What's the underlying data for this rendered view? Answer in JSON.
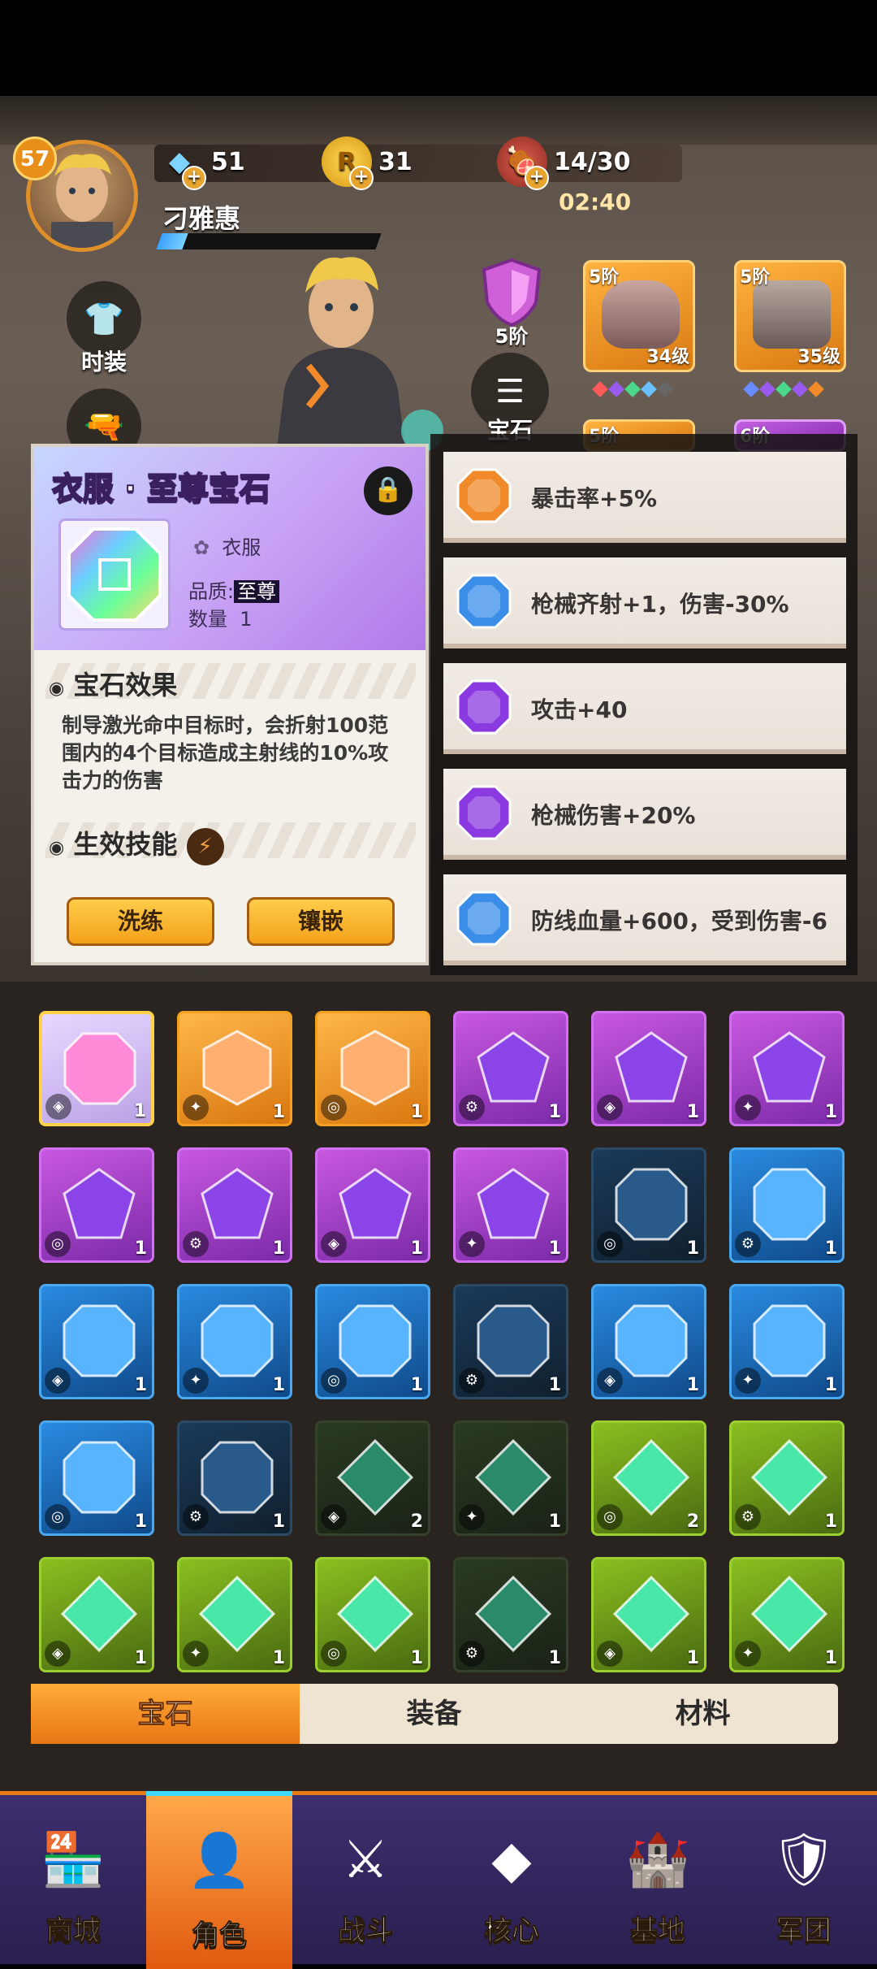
{
  "player": {
    "level": "57",
    "name": "刁雅惠",
    "xp_fraction": 0.12
  },
  "resources": [
    {
      "name": "diamond",
      "icon": "diamond-icon",
      "value": "51"
    },
    {
      "name": "r-coin",
      "icon": "r-coin-icon",
      "value": "31"
    },
    {
      "name": "stamina",
      "icon": "meat-icon",
      "value": "14/30"
    }
  ],
  "timer": "02:40",
  "side_buttons": [
    {
      "label": "时装",
      "icon": "outfit-icon"
    },
    {
      "label": "宝石",
      "icon": "list-icon"
    }
  ],
  "shield_tier": "5阶",
  "equipment": [
    {
      "tier": "5阶",
      "level": "34级"
    },
    {
      "tier": "5阶",
      "level": "35级"
    },
    {
      "tier": "5阶",
      "level": ""
    },
    {
      "tier": "6阶",
      "level": ""
    }
  ],
  "popup": {
    "title": "衣服 · 至尊宝石",
    "slot_label": "衣服",
    "quality_label": "品质:",
    "quality_value": "至尊",
    "count_label": "数量",
    "count_value": "1",
    "effect_title": "宝石效果",
    "effect_desc": "制导激光命中目标时，会折射100范围内的4个目标造成主射线的10%攻击力的伤害",
    "skill_title": "生效技能",
    "btn_refine": "洗练",
    "btn_inlay": "镶嵌"
  },
  "stats": [
    {
      "text": "暴击率+5%",
      "color": "#f08a2a"
    },
    {
      "text": "枪械齐射+1，伤害-30%",
      "color": "#3a8ee8"
    },
    {
      "text": "攻击+40",
      "color": "#8a3ae0"
    },
    {
      "text": "枪械伤害+20%",
      "color": "#8a3ae0"
    },
    {
      "text": "防线血量+600，受到伤害-6",
      "color": "#3a8ee8"
    }
  ],
  "inventory": [
    {
      "kind": "rainbow",
      "count": "1"
    },
    {
      "kind": "orange",
      "count": "1"
    },
    {
      "kind": "orange",
      "count": "1"
    },
    {
      "kind": "purple",
      "count": "1"
    },
    {
      "kind": "purple",
      "count": "1"
    },
    {
      "kind": "purple",
      "count": "1"
    },
    {
      "kind": "purple",
      "count": "1"
    },
    {
      "kind": "purple",
      "count": "1"
    },
    {
      "kind": "purple",
      "count": "1"
    },
    {
      "kind": "purple",
      "count": "1"
    },
    {
      "kind": "blue-dim",
      "count": "1"
    },
    {
      "kind": "blue",
      "count": "1"
    },
    {
      "kind": "blue",
      "count": "1"
    },
    {
      "kind": "blue",
      "count": "1"
    },
    {
      "kind": "blue",
      "count": "1"
    },
    {
      "kind": "blue-dim",
      "count": "1"
    },
    {
      "kind": "blue",
      "count": "1"
    },
    {
      "kind": "blue",
      "count": "1"
    },
    {
      "kind": "blue",
      "count": "1"
    },
    {
      "kind": "blue-dim",
      "count": "1"
    },
    {
      "kind": "green-dim",
      "count": "2"
    },
    {
      "kind": "green-dim",
      "count": "1"
    },
    {
      "kind": "green",
      "count": "2"
    },
    {
      "kind": "green",
      "count": "1"
    },
    {
      "kind": "green",
      "count": "1"
    },
    {
      "kind": "green",
      "count": "1"
    },
    {
      "kind": "green",
      "count": "1"
    },
    {
      "kind": "green-dim",
      "count": "1"
    },
    {
      "kind": "green",
      "count": "1"
    },
    {
      "kind": "green",
      "count": "1"
    }
  ],
  "tabs": [
    {
      "label": "宝石",
      "active": true
    },
    {
      "label": "装备",
      "active": false
    },
    {
      "label": "材料",
      "active": false
    }
  ],
  "nav": [
    {
      "label": "商城",
      "icon": "shop-icon",
      "glyph": "🏪",
      "active": false
    },
    {
      "label": "角色",
      "icon": "character-icon",
      "glyph": "👤",
      "active": true
    },
    {
      "label": "战斗",
      "icon": "battle-icon",
      "glyph": "⚔",
      "active": false
    },
    {
      "label": "核心",
      "icon": "core-icon",
      "glyph": "◆",
      "active": false
    },
    {
      "label": "基地",
      "icon": "base-icon",
      "glyph": "🏰",
      "active": false
    },
    {
      "label": "军团",
      "icon": "legion-icon",
      "glyph": "🛡",
      "active": false
    }
  ]
}
